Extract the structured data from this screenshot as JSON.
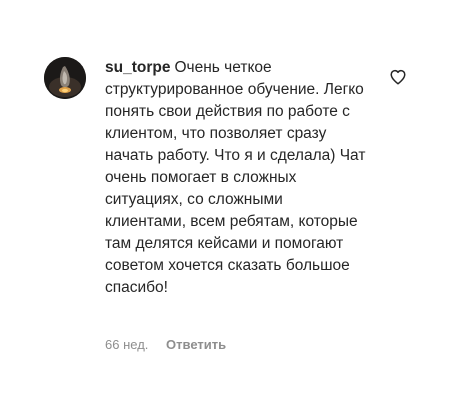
{
  "comment": {
    "username": "su_torpe",
    "text": "Очень четкое структурированное обучение. Легко понять свои действия по работе с клиентом, что позволяет сразу начать работу. Что я и сделала) Чат очень помогает в сложных ситуациях, со сложными клиентами, всем ребятам, которые там делятся кейсами и помогают советом хочется сказать большое спасибо!",
    "time": "66 нед.",
    "reply_label": "Ответить",
    "like_icon": "heart-outline-icon",
    "avatar_icon": "profile-photo"
  },
  "colors": {
    "text": "#262626",
    "secondary": "#8e8e8e",
    "background": "#ffffff"
  }
}
